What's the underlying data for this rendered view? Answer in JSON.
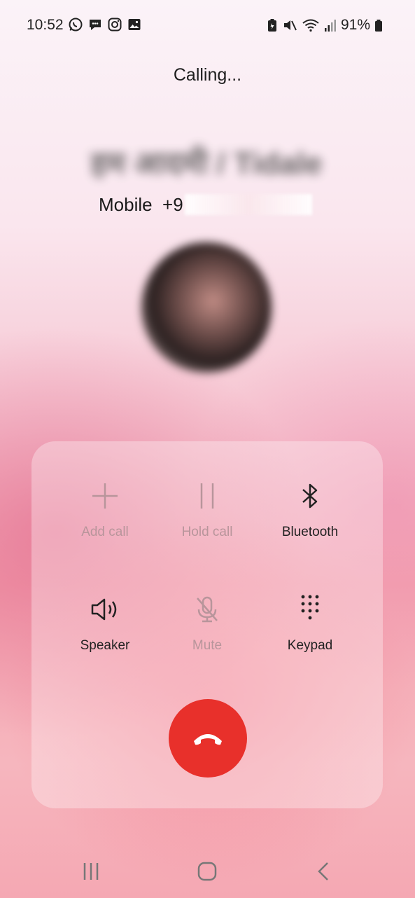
{
  "status_bar": {
    "time": "10:52",
    "battery_percent": "91%",
    "left_icons": [
      "whatsapp-icon",
      "messages-icon",
      "instagram-icon",
      "gallery-icon"
    ],
    "right_icons": [
      "battery-saver-icon",
      "mute-icon",
      "wifi-icon",
      "signal-icon",
      "battery-icon"
    ]
  },
  "call": {
    "status": "Calling...",
    "contact_name": "हम आदमी / Tidale",
    "number_label": "Mobile  +9"
  },
  "controls": [
    {
      "label": "Add call",
      "icon": "plus-icon",
      "enabled": false
    },
    {
      "label": "Hold call",
      "icon": "pause-icon",
      "enabled": false
    },
    {
      "label": "Bluetooth",
      "icon": "bluetooth-icon",
      "enabled": true
    },
    {
      "label": "Speaker",
      "icon": "speaker-icon",
      "enabled": true
    },
    {
      "label": "Mute",
      "icon": "mic-off-icon",
      "enabled": false
    },
    {
      "label": "Keypad",
      "icon": "keypad-icon",
      "enabled": true
    }
  ],
  "end_call": {
    "icon": "end-call-icon",
    "color": "#e8302b"
  },
  "nav_bar": {
    "icons": [
      "recents-icon",
      "home-icon",
      "back-icon"
    ]
  },
  "colors": {
    "accent_end_call": "#e8302b",
    "disabled": "#b8959b",
    "enabled": "#222222"
  }
}
